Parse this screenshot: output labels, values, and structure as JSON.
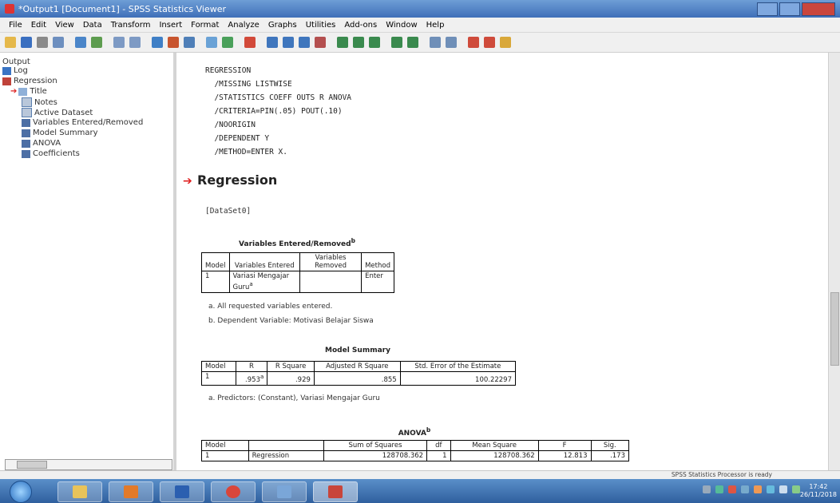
{
  "window": {
    "title": "*Output1 [Document1] - SPSS Statistics Viewer"
  },
  "menu": [
    "File",
    "Edit",
    "View",
    "Data",
    "Transform",
    "Insert",
    "Format",
    "Analyze",
    "Graphs",
    "Utilities",
    "Add-ons",
    "Window",
    "Help"
  ],
  "outline": {
    "items": [
      {
        "label": "Output",
        "icon": "output-icon"
      },
      {
        "label": "Log",
        "icon": "log-icon"
      },
      {
        "label": "Regression",
        "icon": "regression-icon"
      },
      {
        "label": "Title",
        "icon": "title-icon"
      },
      {
        "label": "Notes",
        "icon": "notes-icon"
      },
      {
        "label": "Active Dataset",
        "icon": "dataset-icon"
      },
      {
        "label": "Variables Entered/Removed",
        "icon": "table-icon"
      },
      {
        "label": "Model Summary",
        "icon": "table-icon"
      },
      {
        "label": "ANOVA",
        "icon": "table-icon"
      },
      {
        "label": "Coefficients",
        "icon": "table-icon"
      }
    ]
  },
  "syntax": "REGRESSION\n  /MISSING LISTWISE\n  /STATISTICS COEFF OUTS R ANOVA\n  /CRITERIA=PIN(.05) POUT(.10)\n  /NOORIGIN\n  /DEPENDENT Y\n  /METHOD=ENTER X.",
  "section_heading": "Regression",
  "dataset_label": "[DataSet0]",
  "variables_table": {
    "title": "Variables Entered/Removed",
    "title_sup": "b",
    "headers": [
      "Model",
      "Variables Entered",
      "Variables Removed",
      "Method"
    ],
    "row": {
      "model": "1",
      "entered": "Variasi Mengajar Guru",
      "entered_sup": "a",
      "removed": "",
      "method": "Enter"
    },
    "notes": [
      "a. All requested variables entered.",
      "b. Dependent Variable: Motivasi Belajar Siswa"
    ]
  },
  "model_summary": {
    "title": "Model Summary",
    "headers": [
      "Model",
      "R",
      "R Square",
      "Adjusted R Square",
      "Std. Error of the Estimate"
    ],
    "row": {
      "model": "1",
      "r": ".953",
      "r_sup": "a",
      "r_square": ".929",
      "adj_r_square": ".855",
      "std_error": "100.22297"
    },
    "notes": [
      "a. Predictors: (Constant), Variasi Mengajar Guru"
    ]
  },
  "anova": {
    "title": "ANOVA",
    "title_sup": "b",
    "headers": [
      "Model",
      "",
      "Sum of Squares",
      "df",
      "Mean Square",
      "F",
      "Sig."
    ],
    "row": {
      "model": "1",
      "label": "Regression",
      "ss": "128708.362",
      "df": "1",
      "ms": "128708.362",
      "f": "12.813",
      "sig": ".173"
    }
  },
  "status": {
    "text": "SPSS Statistics Processor is ready"
  },
  "clock": {
    "time": "17:42",
    "date": "26/11/2018"
  },
  "colors": {
    "titlebar": "#4a7cc2",
    "accent_arrow": "#e02020",
    "taskbar": "#3b6fb0"
  }
}
